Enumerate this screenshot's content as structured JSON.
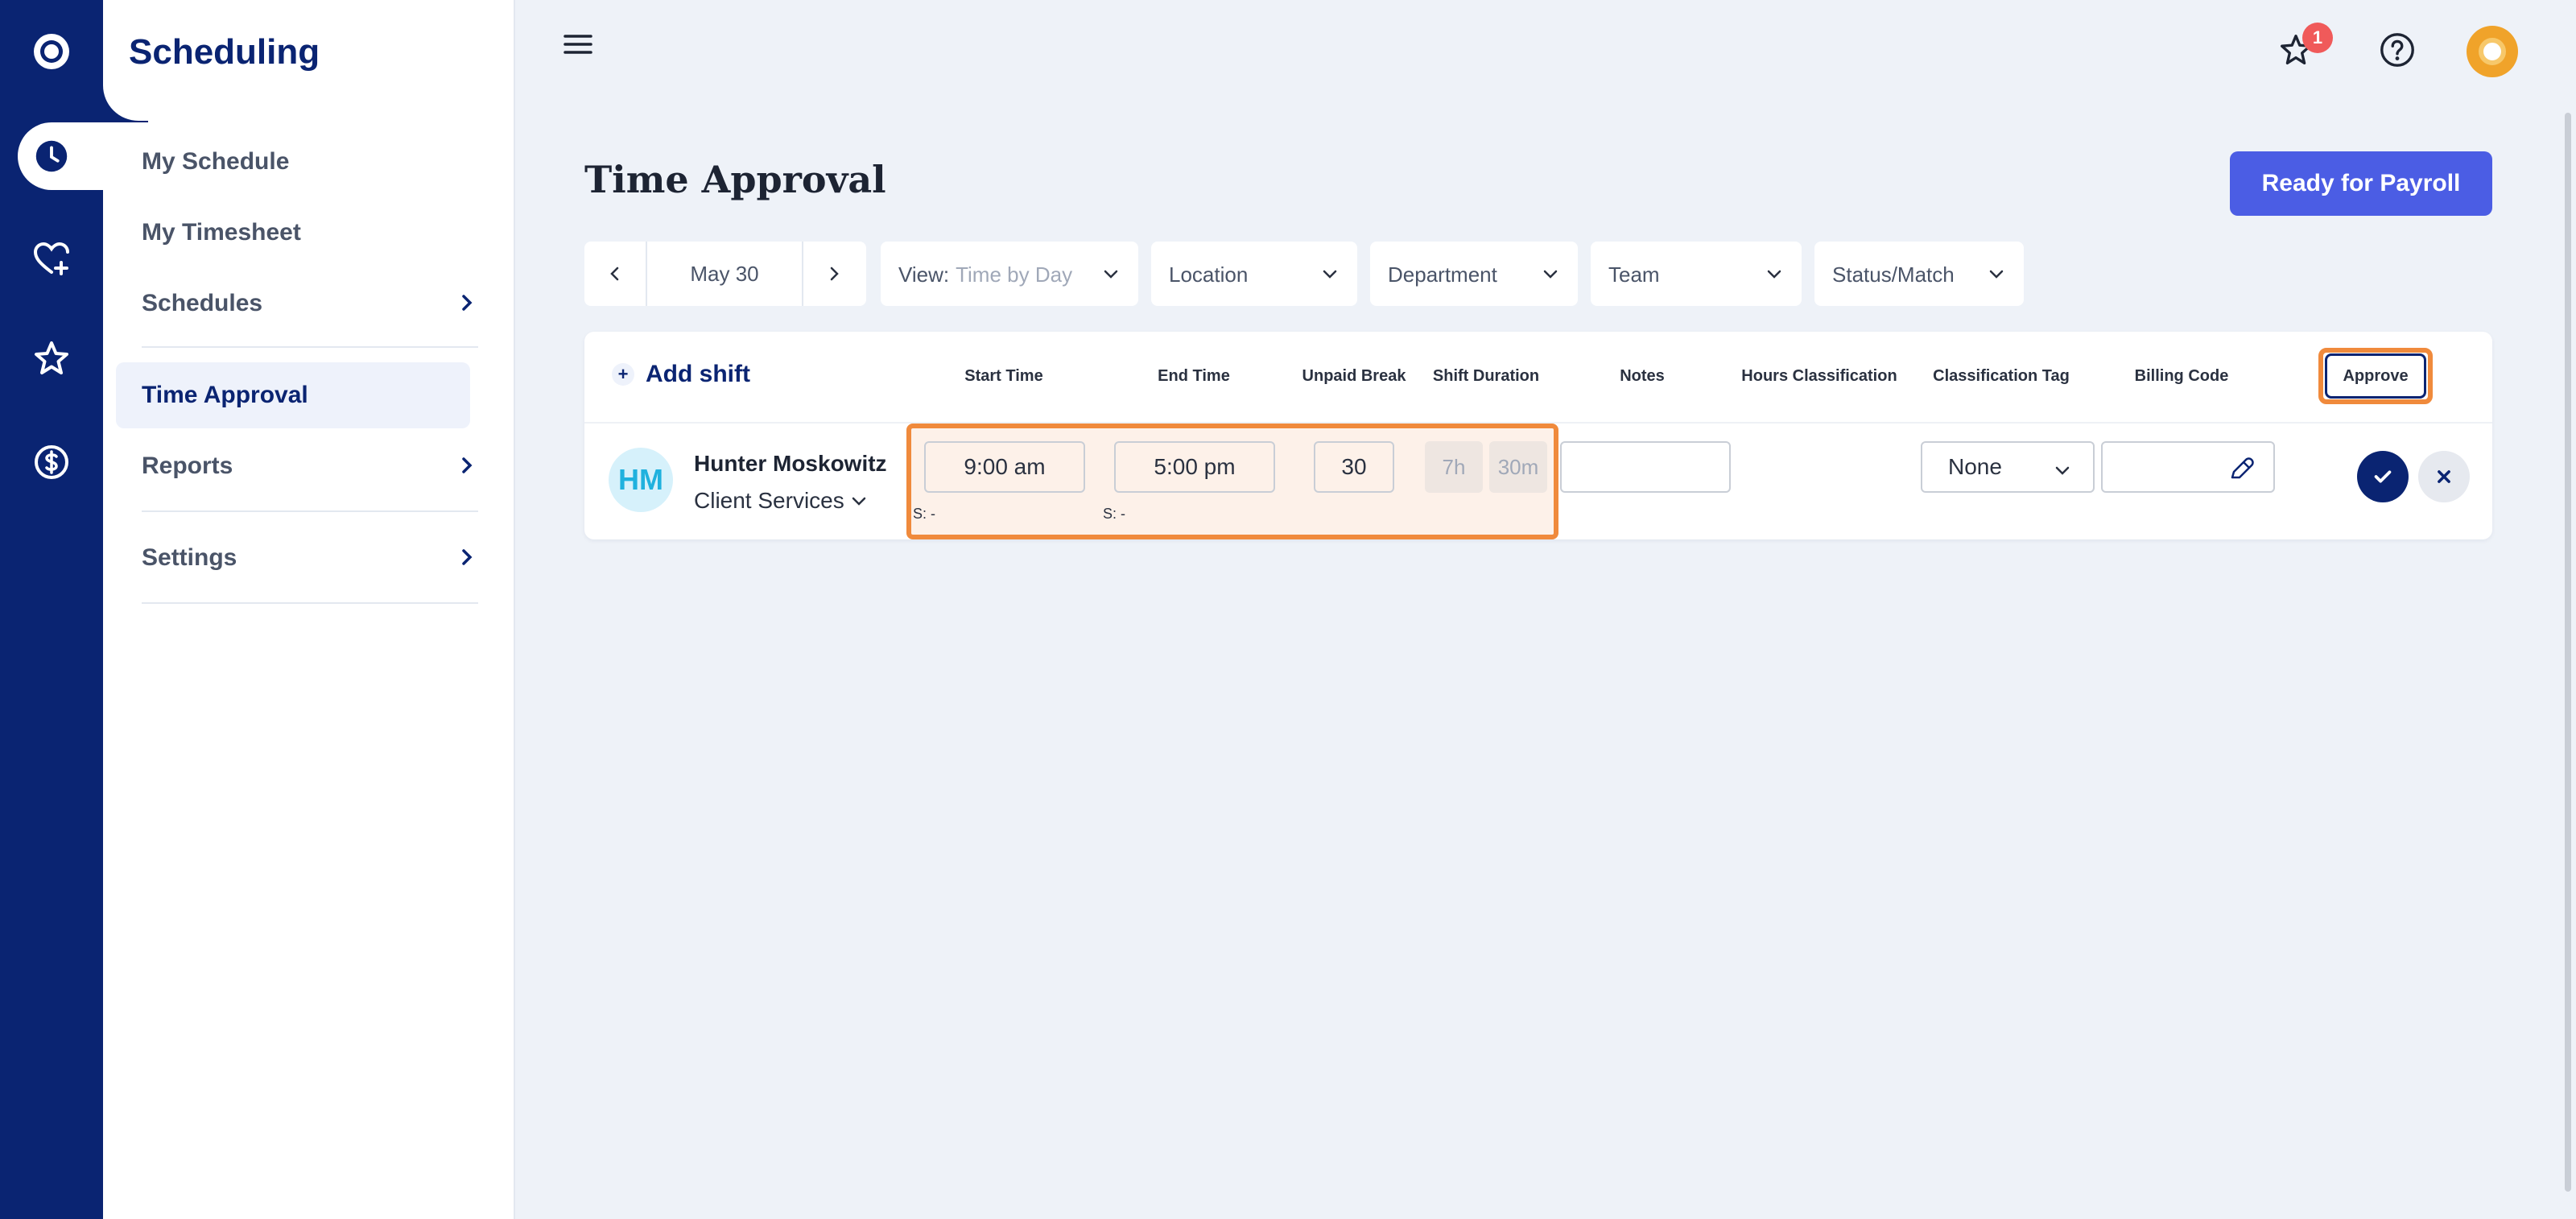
{
  "sidebar": {
    "brand": "Scheduling",
    "items": [
      {
        "label": "My Schedule"
      },
      {
        "label": "My Timesheet"
      },
      {
        "label": "Schedules"
      },
      {
        "label": "Time Approval"
      },
      {
        "label": "Reports"
      },
      {
        "label": "Settings"
      }
    ]
  },
  "topbar": {
    "notification_count": "1"
  },
  "header": {
    "title": "Time Approval",
    "payroll_button": "Ready for Payroll"
  },
  "filters": {
    "date": "May 30",
    "view_label": "View:",
    "view_value": "Time by Day",
    "location": "Location",
    "department": "Department",
    "team": "Team",
    "status": "Status/Match"
  },
  "table": {
    "add_shift": "Add shift",
    "columns": {
      "start_time": "Start Time",
      "end_time": "End Time",
      "unpaid_break": "Unpaid Break",
      "shift_duration": "Shift Duration",
      "notes": "Notes",
      "hours_classification": "Hours Classification",
      "classification_tag": "Classification Tag",
      "billing_code": "Billing Code",
      "approve": "Approve"
    },
    "row": {
      "initials": "HM",
      "name": "Hunter Moskowitz",
      "department": "Client Services",
      "start_time": "9:00 am",
      "end_time": "5:00 pm",
      "start_sched": "S:  -",
      "end_sched": "S:  -",
      "unpaid_break": "30",
      "duration_hours": "7h",
      "duration_minutes": "30m",
      "classification_tag": "None"
    }
  },
  "colors": {
    "rail": "#0a2472",
    "accent": "#4b5de4",
    "highlight": "#f08a3c"
  }
}
